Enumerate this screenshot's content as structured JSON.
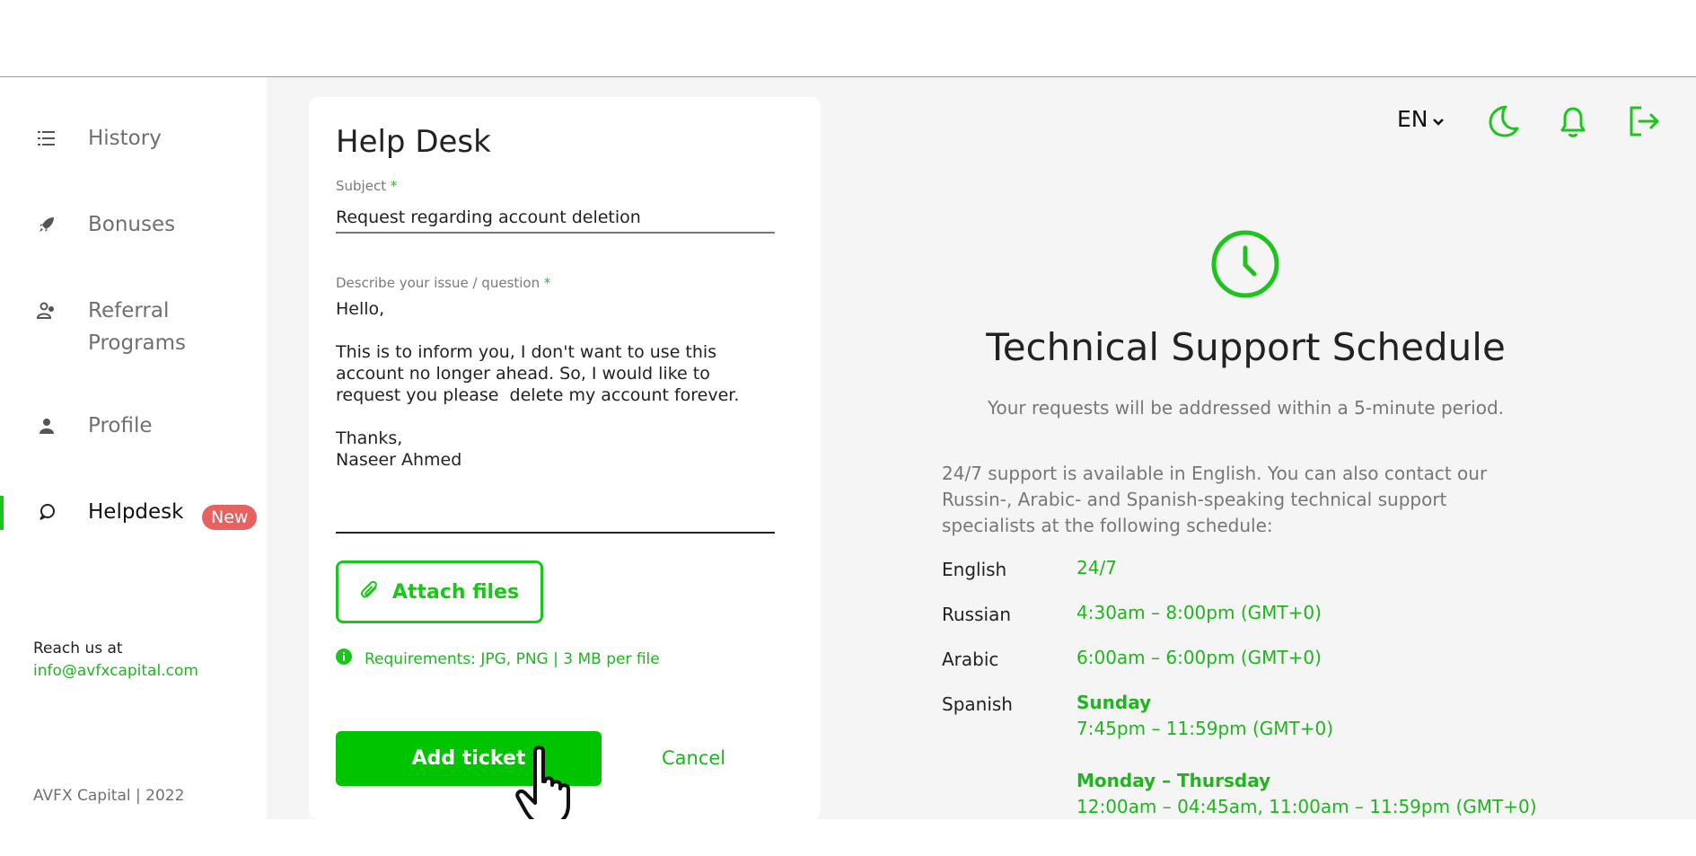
{
  "sidebar": {
    "items": [
      {
        "label": "History",
        "icon": "list-icon"
      },
      {
        "label": "Bonuses",
        "icon": "rocket-icon"
      },
      {
        "label": "Referral\nPrograms",
        "icon": "referral-icon"
      },
      {
        "label": "Profile",
        "icon": "user-icon"
      },
      {
        "label": "Helpdesk",
        "icon": "chat-icon",
        "badge": "New",
        "active": true
      }
    ],
    "reach_label": "Reach us at",
    "reach_email": "info@avfxcapital.com",
    "copyright": "AVFX Capital | 2022"
  },
  "form": {
    "title": "Help Desk",
    "subject_label": "Subject",
    "required_mark": "*",
    "subject_value": "Request regarding account deletion",
    "issue_label": "Describe your issue / question",
    "issue_value": "Hello,\n\nThis is to inform you, I don't want to use this\naccount no longer ahead. So, I would like to\nrequest you please  delete my account forever.\n\nThanks,\nNaseer Ahmed",
    "attach_label": "Attach files",
    "requirements": "Requirements: JPG, PNG | 3 MB per file",
    "submit_label": "Add ticket",
    "cancel_label": "Cancel"
  },
  "header": {
    "language": "EN"
  },
  "schedule": {
    "title": "Technical Support Schedule",
    "subtitle": "Your requests will be addressed within a 5-minute period.",
    "description": "24/7 support is available in English. You can also contact our Russin-, Arabic- and Spanish-speaking technical support specialists at the following schedule:",
    "rows": [
      {
        "language": "English",
        "value": "24/7"
      },
      {
        "language": "Russian",
        "value": "4:30am – 8:00pm (GMT+0)"
      },
      {
        "language": "Arabic",
        "value": "6:00am – 6:00pm (GMT+0)"
      },
      {
        "language": "Spanish",
        "day1": "Sunday",
        "value1": "7:45pm – 11:59pm (GMT+0)",
        "day2": "Monday – Thursday",
        "value2": "12:00am – 04:45am, 11:00am – 11:59pm (GMT+0)"
      }
    ]
  },
  "colors": {
    "accent": "#1cc51c",
    "badge": "#e86161"
  }
}
